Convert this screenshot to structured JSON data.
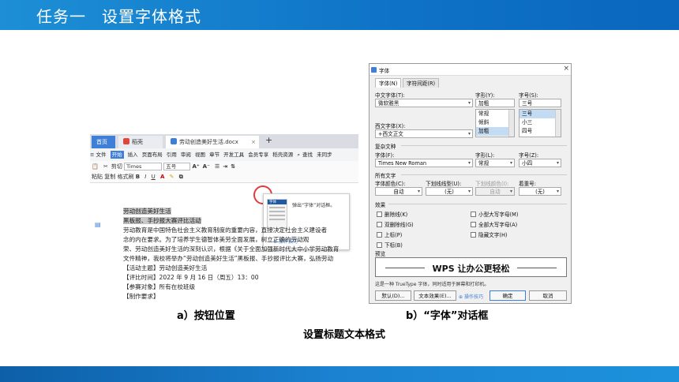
{
  "slide": {
    "title_part1": "任务一",
    "title_part2": "设置字体格式",
    "caption_a": "a）按钮位置",
    "caption_b": "b）“字体”对话框",
    "caption_main": "设置标题文本格式"
  },
  "editor": {
    "tabs": {
      "home": "首页",
      "draft": "稻壳",
      "doc": "劳动创造美好生活.docx",
      "plus": "+"
    },
    "menu": {
      "file": "≡ 文件",
      "items": [
        "开始",
        "插入",
        "页面布局",
        "引用",
        "审阅",
        "视图",
        "章节",
        "开发工具",
        "会员专享",
        "稻壳资源"
      ],
      "search": "查找",
      "share": "未同步"
    },
    "ribbon": {
      "cut": "剪切",
      "paste": "粘贴",
      "copy": "复制",
      "format_painter": "格式刷",
      "font_name": "Times",
      "font_size": "五号",
      "bold": "B",
      "italic": "I",
      "underline": "U"
    },
    "popup": {
      "mini_title": "字体",
      "hint": "弹出“字体”对话框。",
      "tip": "操作技巧"
    },
    "lines": [
      "劳动创造美好生活",
      "黑板报、手抄报大赛评比活动",
      "劳动教育是中国特色社会主义教育制度的重要内容，直接决定社会主义建设者",
      "念的内在要求。为了培养学生德智体美劳全面发展，树立正确的劳动观",
      "荣、劳动创造美好生活的深刻认识，根据《关于全面加强新时代大中小学劳动教育",
      "文件精神，我校将举办“劳动创造美好生活”黑板报、手抄报评比大赛，弘扬劳动",
      "【活动主题】劳动创造美好生活",
      "【评比时间】2022 年 9 月 16 日（周五）13：00",
      "【参赛对象】所有在校班级",
      "【制作要求】"
    ]
  },
  "dialog": {
    "title": "字体",
    "close": "×",
    "tab_font": "字体(N)",
    "tab_spacing": "字符间距(R)",
    "cn_font_label": "中文字体(T):",
    "cn_font_value": "微软雅黑",
    "style_label": "字形(Y):",
    "style_value": "加粗",
    "style_options": [
      "常规",
      "倾斜",
      "加粗"
    ],
    "size_label": "字号(S):",
    "size_value": "三号",
    "size_options": [
      "三号",
      "小三",
      "四号"
    ],
    "west_font_label": "西文字体(X):",
    "west_font_value": "+西文正文",
    "complex_section": "复杂文种",
    "complex_font_label": "字体(F):",
    "complex_font_value": "Times New Roman",
    "complex_style_label": "字形(L):",
    "complex_style_value": "常规",
    "complex_size_label": "字号(Z):",
    "complex_size_value": "小四",
    "all_text_section": "所有文字",
    "color_label": "字体颜色(C):",
    "color_value": "自动",
    "underline_label": "下划线线型(U):",
    "underline_value": "(无)",
    "underline_color_label": "下划线颜色(I):",
    "underline_color_value": "自动",
    "emphasis_label": "着重号:",
    "emphasis_value": "(无)",
    "effects_section": "效果",
    "effects_left": [
      "删除线(K)",
      "双删除线(G)",
      "上标(P)",
      "下标(B)"
    ],
    "effects_right": [
      "小型大写字母(M)",
      "全部大写字母(A)",
      "隐藏文字(H)"
    ],
    "preview_section": "预览",
    "preview_text": "WPS 让办公更轻松",
    "note": "这是一种 TrueType 字体，同时适用于屏幕和打印机。",
    "btn_default": "默认(D)...",
    "btn_effects": "文本效果(E)...",
    "btn_tip": "操作技巧",
    "btn_ok": "确定",
    "btn_cancel": "取消"
  }
}
